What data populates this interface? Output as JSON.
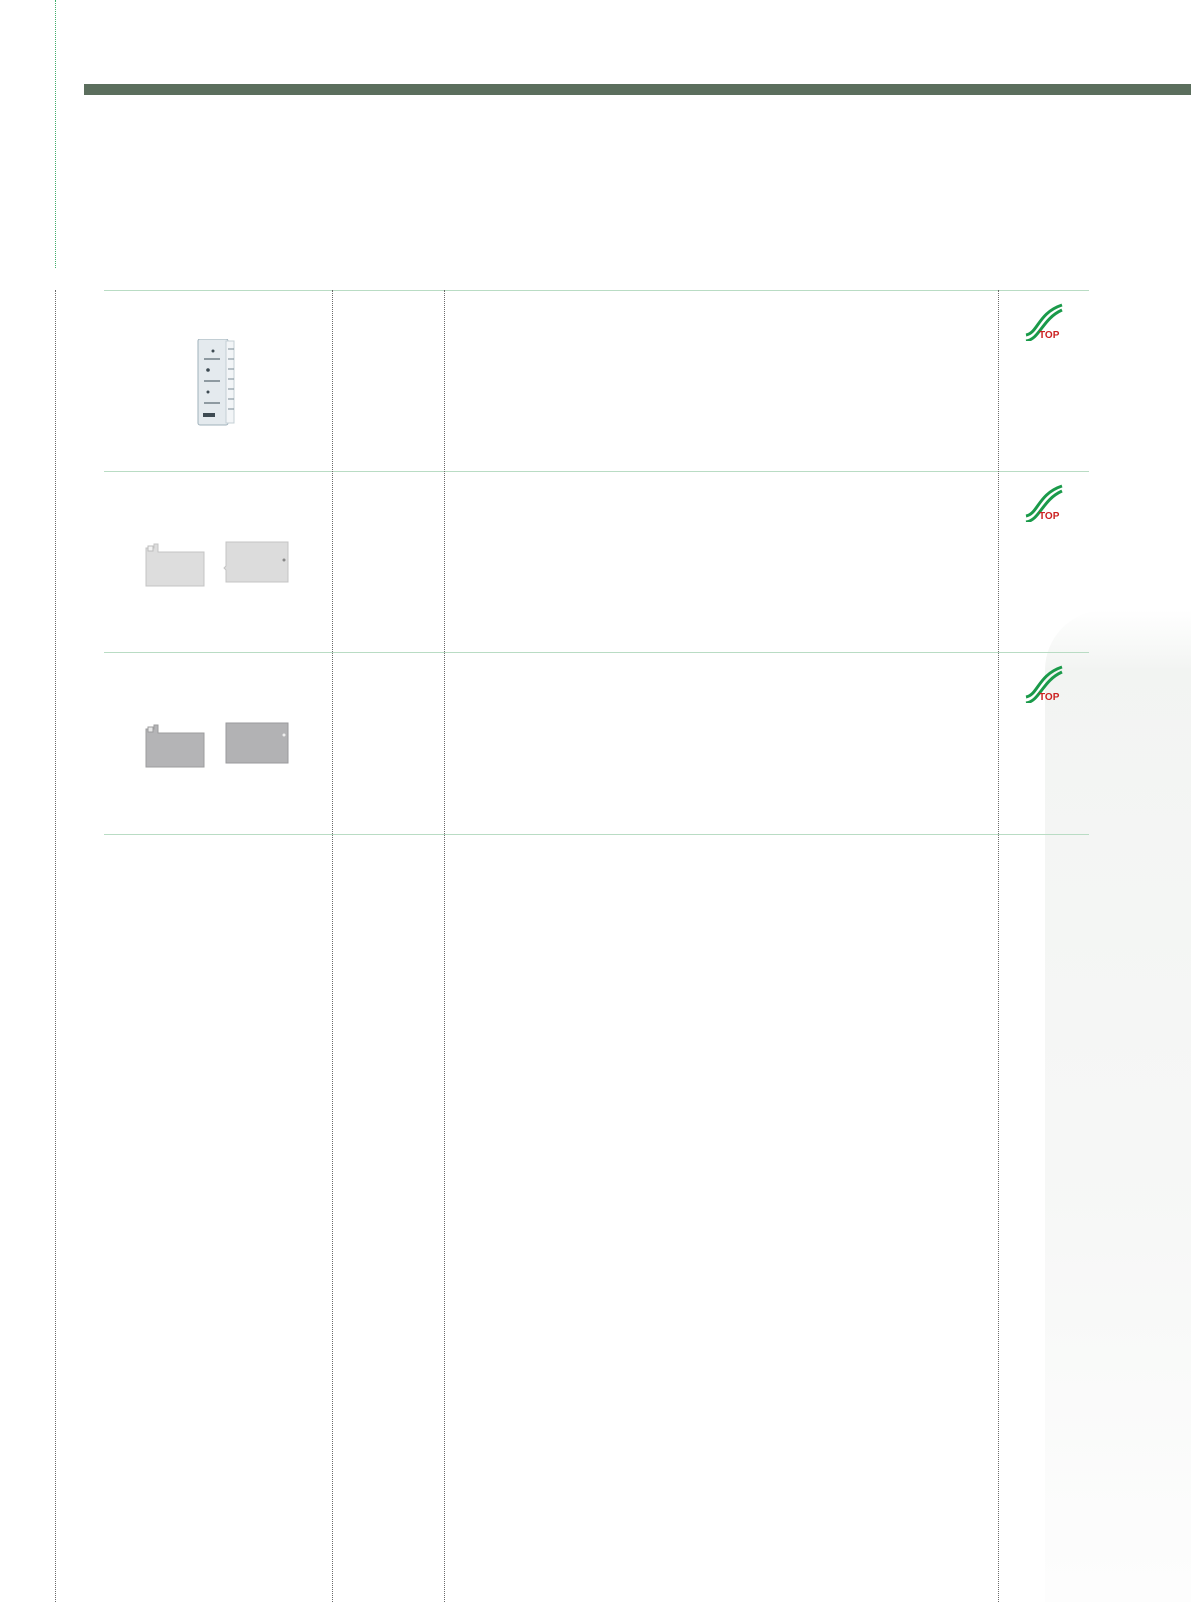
{
  "header": {
    "bar_color": "#5b6e5d"
  },
  "table": {
    "rows": [
      {
        "image": "door-shelf-part-icon",
        "top_link": {
          "label": "TOP",
          "icon": "top-arrow-icon"
        }
      },
      {
        "image": "light-gray-cover-plates-icon",
        "top_link": {
          "label": "TOP",
          "icon": "top-arrow-icon"
        }
      },
      {
        "image": "dark-gray-cover-plates-icon",
        "top_link": {
          "label": "TOP",
          "icon": "top-arrow-icon"
        }
      }
    ]
  },
  "colors": {
    "accent_green": "#1a9a4a",
    "top_red": "#cc2222",
    "rule_green": "#b9dcc4"
  }
}
